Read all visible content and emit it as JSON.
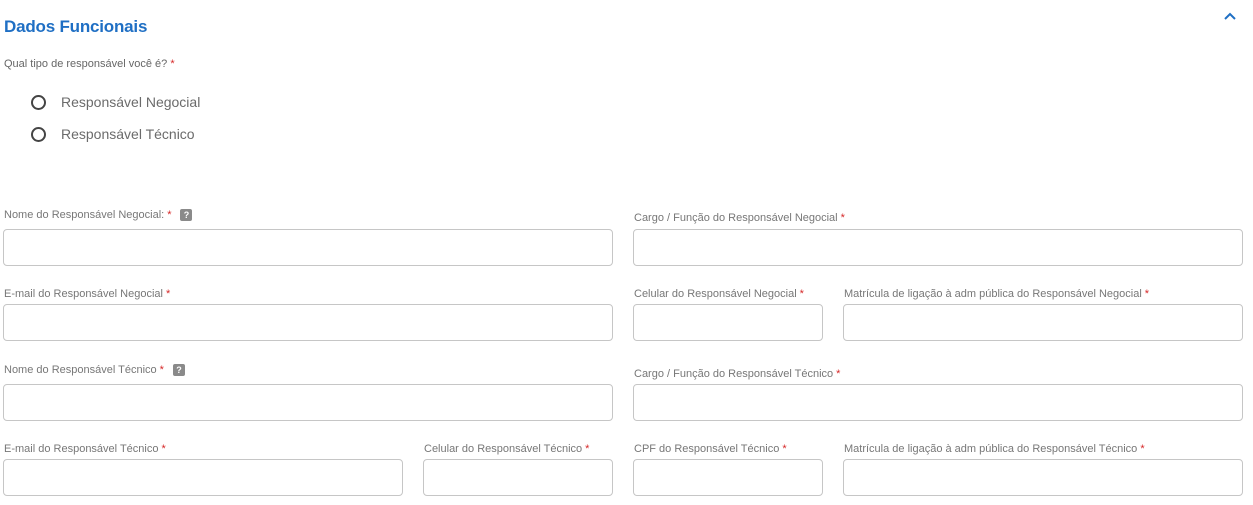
{
  "section": {
    "title": "Dados Funcionais",
    "collapse_icon": "chevron-up-icon"
  },
  "question": {
    "label": "Qual tipo de responsável você é?",
    "required_mark": "*"
  },
  "radio_options": [
    {
      "label": "Responsável Negocial",
      "selected": false
    },
    {
      "label": "Responsável Técnico",
      "selected": false
    }
  ],
  "fields": {
    "nome_negocial": {
      "label": "Nome do Responsável Negocial:",
      "required_mark": "*",
      "help": "?",
      "value": ""
    },
    "cargo_negocial": {
      "label": "Cargo / Função do Responsável Negocial",
      "required_mark": "*",
      "value": ""
    },
    "email_negocial": {
      "label": "E-mail do Responsável Negocial",
      "required_mark": "*",
      "value": ""
    },
    "celular_negocial": {
      "label": "Celular do Responsável Negocial",
      "required_mark": "*",
      "value": ""
    },
    "matricula_negocial": {
      "label": "Matrícula de ligação à adm pública do Responsável Negocial",
      "required_mark": "*",
      "value": ""
    },
    "nome_tecnico": {
      "label": "Nome do Responsável Técnico",
      "required_mark": "*",
      "help": "?",
      "value": ""
    },
    "cargo_tecnico": {
      "label": "Cargo / Função do Responsável Técnico",
      "required_mark": "*",
      "value": ""
    },
    "email_tecnico": {
      "label": "E-mail do Responsável Técnico",
      "required_mark": "*",
      "value": ""
    },
    "celular_tecnico": {
      "label": "Celular do Responsável Técnico",
      "required_mark": "*",
      "value": ""
    },
    "cpf_tecnico": {
      "label": "CPF do Responsável Técnico",
      "required_mark": "*",
      "value": ""
    },
    "matricula_tecnico": {
      "label": "Matrícula de ligação à adm pública do Responsável Técnico",
      "required_mark": "*",
      "value": ""
    }
  },
  "colors": {
    "title": "#1f6fc4",
    "required": "#d62828",
    "border": "#c6c6c6"
  }
}
